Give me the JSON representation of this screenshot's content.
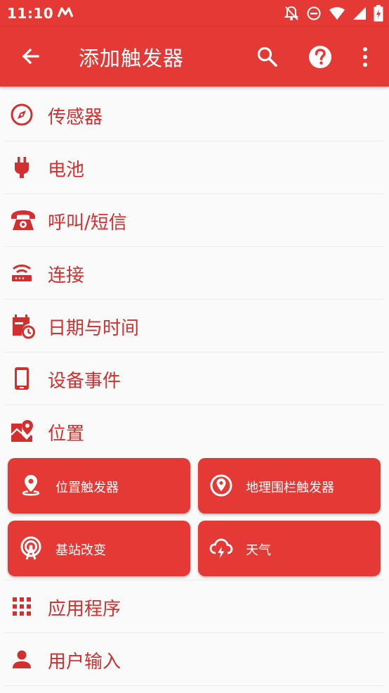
{
  "status_bar": {
    "time": "11:10"
  },
  "app_bar": {
    "title": "添加触发器"
  },
  "categories": {
    "sensors": "传感器",
    "battery": "电池",
    "call_sms": "呼叫/短信",
    "connectivity": "连接",
    "date_time": "日期与时间",
    "device_events": "设备事件",
    "location": "位置",
    "applications": "应用程序",
    "user_input": "用户输入"
  },
  "location_triggers": {
    "location_trigger": "位置触发器",
    "geofence_trigger": "地理围栏触发器",
    "cell_tower_change": "基站改变",
    "weather": "天气"
  },
  "colors": {
    "primary": "#e53935",
    "text_accent": "#d32f2f",
    "background": "#fafafa"
  }
}
